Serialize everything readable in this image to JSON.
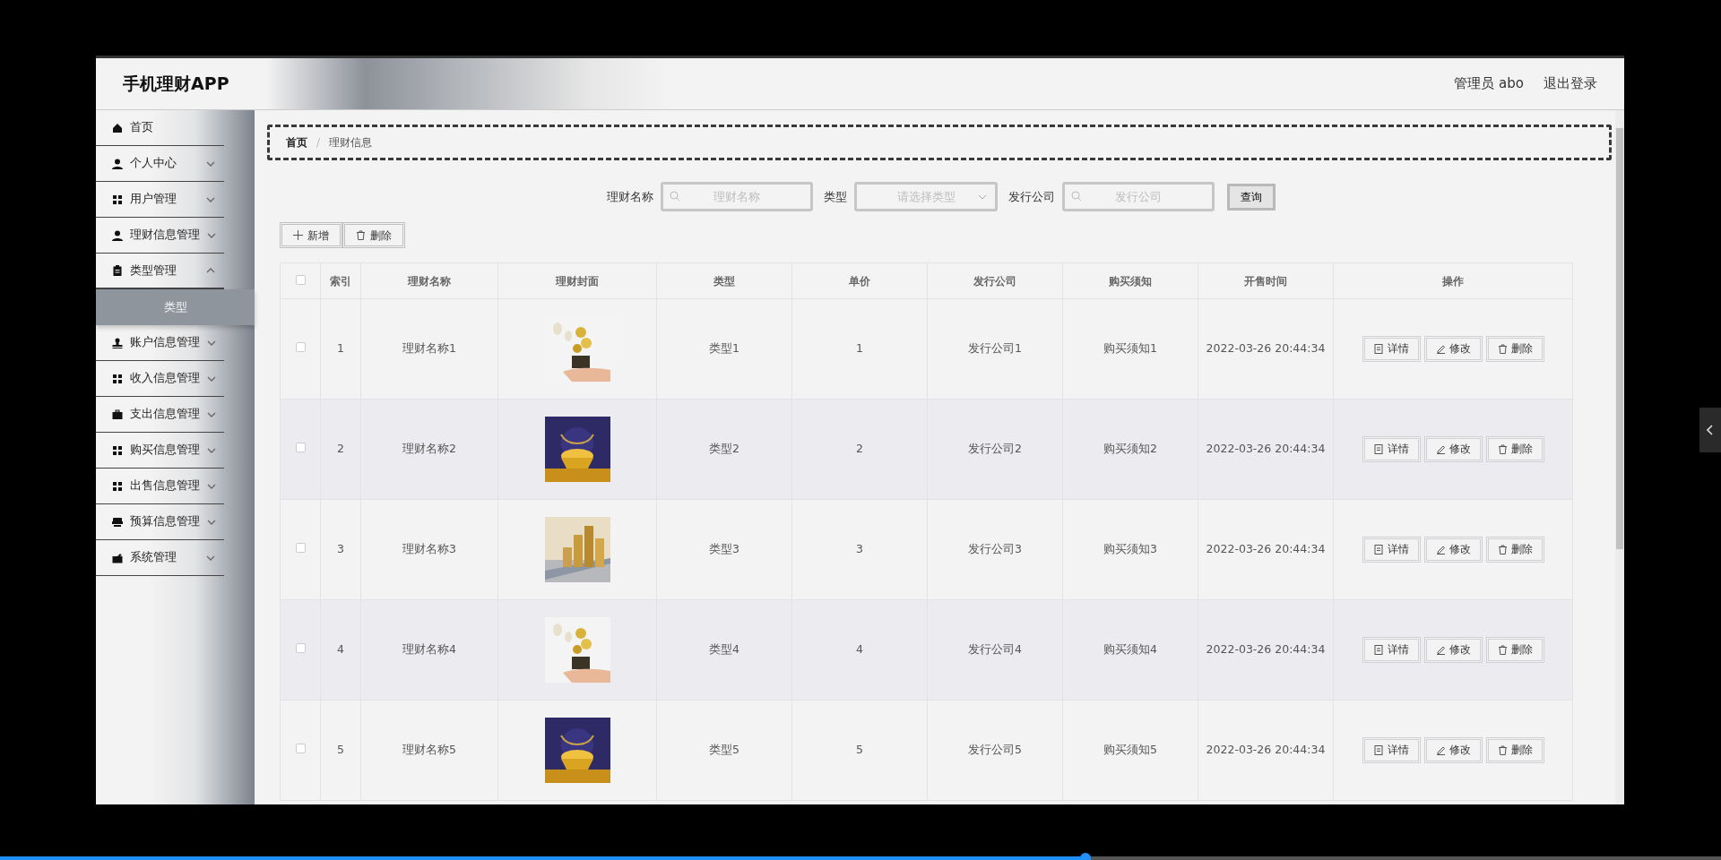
{
  "header": {
    "title": "手机理财APP",
    "user": "管理员 abo",
    "logout": "退出登录"
  },
  "sidebar": {
    "items": [
      {
        "label": "首页",
        "expandable": false,
        "expanded": false
      },
      {
        "label": "个人中心",
        "expandable": true,
        "expanded": false
      },
      {
        "label": "用户管理",
        "expandable": true,
        "expanded": false
      },
      {
        "label": "理财信息管理",
        "expandable": true,
        "expanded": false
      },
      {
        "label": "类型管理",
        "expandable": true,
        "expanded": true,
        "children": [
          {
            "label": "类型",
            "selected": true
          }
        ]
      },
      {
        "label": "账户信息管理",
        "expandable": true,
        "expanded": false
      },
      {
        "label": "收入信息管理",
        "expandable": true,
        "expanded": false
      },
      {
        "label": "支出信息管理",
        "expandable": true,
        "expanded": false
      },
      {
        "label": "购买信息管理",
        "expandable": true,
        "expanded": false
      },
      {
        "label": "出售信息管理",
        "expandable": true,
        "expanded": false
      },
      {
        "label": "预算信息管理",
        "expandable": true,
        "expanded": false
      },
      {
        "label": "系统管理",
        "expandable": true,
        "expanded": false
      }
    ]
  },
  "breadcrumb": [
    {
      "label": "首页"
    },
    {
      "label": "理财信息"
    }
  ],
  "breadcrumb_separator": "/",
  "search": {
    "fields": [
      {
        "label": "理财名称",
        "kind": "text",
        "placeholder": "理财名称"
      },
      {
        "label": "类型",
        "kind": "select",
        "placeholder": "请选择类型"
      },
      {
        "label": "发行公司",
        "kind": "text",
        "placeholder": "发行公司"
      }
    ],
    "button": "查询"
  },
  "toolbar": [
    {
      "label": "新增",
      "kind": "add"
    },
    {
      "label": "删除",
      "kind": "delete"
    }
  ],
  "table": {
    "all_checked": false,
    "columns": [
      "索引",
      "理财名称",
      "理财封面",
      "类型",
      "单价",
      "发行公司",
      "购买须知",
      "开售时间",
      "操作"
    ],
    "rows": [
      {
        "checked": false,
        "cells": [
          "1",
          "理财名称1",
          "",
          "类型1",
          "1",
          "发行公司1",
          "购买须知1",
          "2022-03-26 20:44:34"
        ],
        "cover": {
          "kind": "picture"
        },
        "actions": [
          {
            "label": "详情",
            "kind": "detail"
          },
          {
            "label": "修改",
            "kind": "edit"
          },
          {
            "label": "删除",
            "kind": "delete"
          }
        ]
      },
      {
        "checked": false,
        "cells": [
          "2",
          "理财名称2",
          "",
          "类型2",
          "2",
          "发行公司2",
          "购买须知2",
          "2022-03-26 20:44:34"
        ],
        "cover": {
          "kind": "picture"
        },
        "actions": [
          {
            "label": "详情",
            "kind": "detail"
          },
          {
            "label": "修改",
            "kind": "edit"
          },
          {
            "label": "删除",
            "kind": "delete"
          }
        ]
      },
      {
        "checked": false,
        "cells": [
          "3",
          "理财名称3",
          "",
          "类型3",
          "3",
          "发行公司3",
          "购买须知3",
          "2022-03-26 20:44:34"
        ],
        "cover": {
          "kind": "picture"
        },
        "actions": [
          {
            "label": "详情",
            "kind": "detail"
          },
          {
            "label": "修改",
            "kind": "edit"
          },
          {
            "label": "删除",
            "kind": "delete"
          }
        ]
      },
      {
        "checked": false,
        "cells": [
          "4",
          "理财名称4",
          "",
          "类型4",
          "4",
          "发行公司4",
          "购买须知4",
          "2022-03-26 20:44:34"
        ],
        "cover": {
          "kind": "picture"
        },
        "actions": [
          {
            "label": "详情",
            "kind": "detail"
          },
          {
            "label": "修改",
            "kind": "edit"
          },
          {
            "label": "删除",
            "kind": "delete"
          }
        ]
      },
      {
        "checked": false,
        "cells": [
          "5",
          "理财名称5",
          "",
          "类型5",
          "5",
          "发行公司5",
          "购买须知5",
          "2022-03-26 20:44:34"
        ],
        "cover": {
          "kind": "picture"
        },
        "actions": [
          {
            "label": "详情",
            "kind": "detail"
          },
          {
            "label": "修改",
            "kind": "edit"
          },
          {
            "label": "删除",
            "kind": "delete"
          }
        ]
      }
    ]
  }
}
